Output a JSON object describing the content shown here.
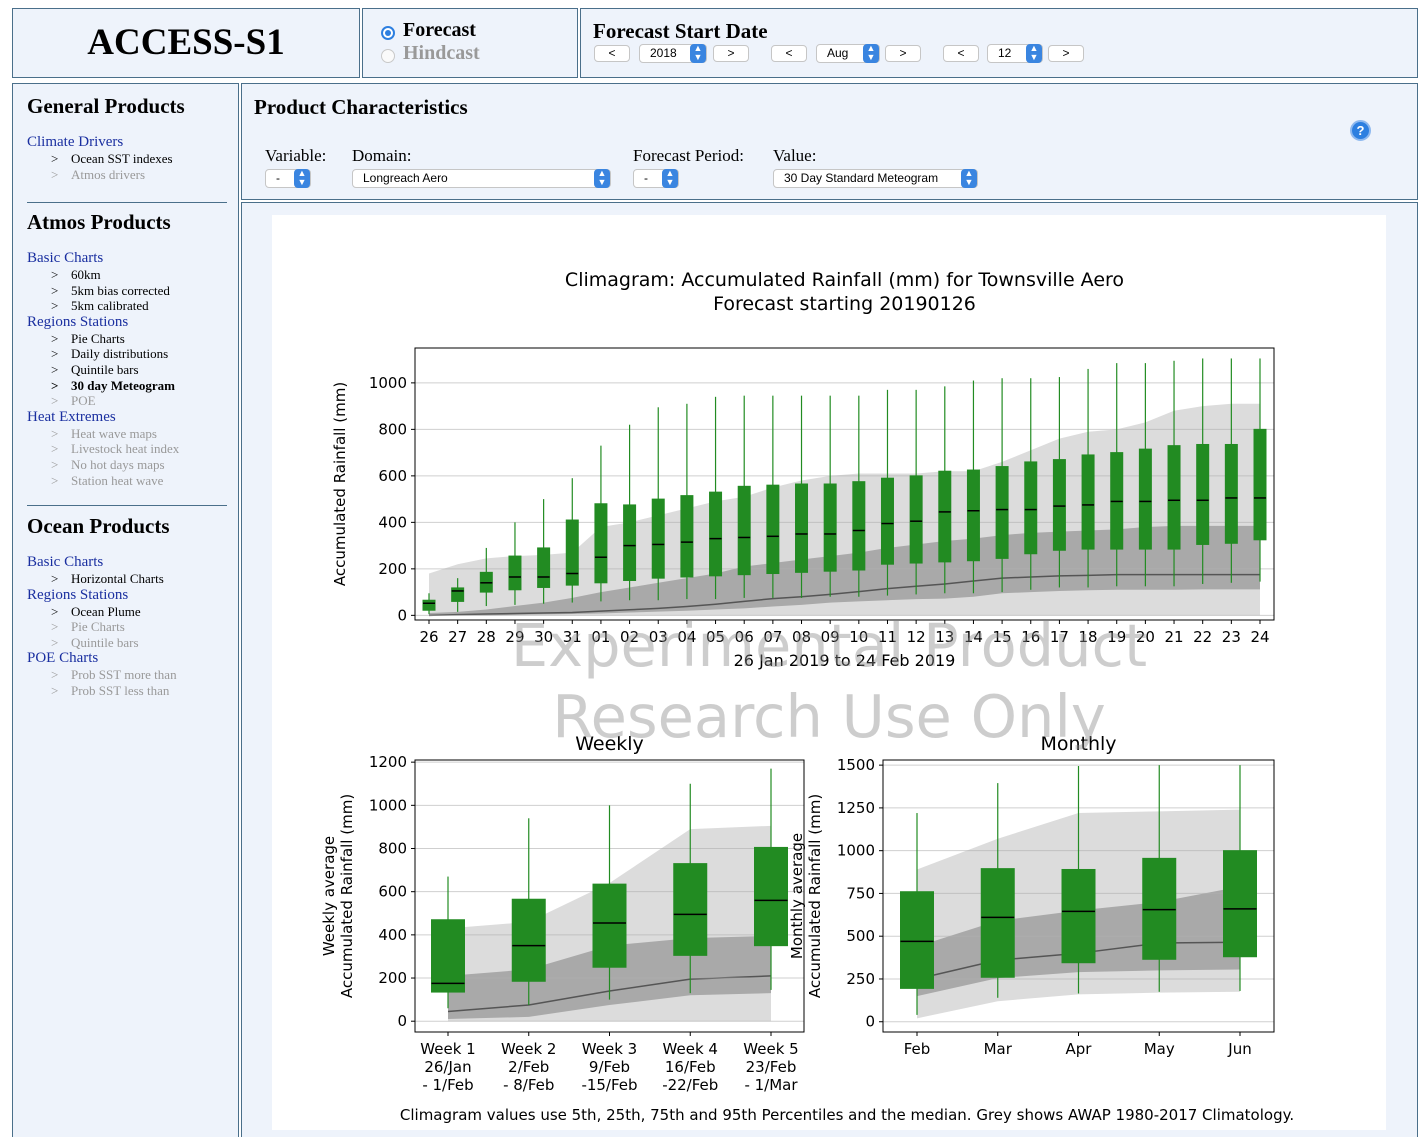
{
  "app": {
    "title": "ACCESS-S1"
  },
  "mode": {
    "forecast_label": "Forecast",
    "hindcast_label": "Hindcast",
    "selected": "Forecast"
  },
  "start_date": {
    "label": "Forecast Start Date",
    "prev": "<",
    "next": ">",
    "year": "2018",
    "month": "Aug",
    "day": "12"
  },
  "sidebar": {
    "general": {
      "heading": "General Products",
      "groups": [
        {
          "label": "Climate Drivers",
          "items": [
            {
              "label": "Ocean SST indexes",
              "state": "active"
            },
            {
              "label": "Atmos drivers",
              "state": "disabled"
            }
          ]
        }
      ]
    },
    "atmos": {
      "heading": "Atmos Products",
      "groups": [
        {
          "label": "Basic Charts",
          "items": [
            {
              "label": "60km",
              "state": "active"
            },
            {
              "label": "5km bias corrected",
              "state": "active"
            },
            {
              "label": "5km calibrated",
              "state": "active"
            }
          ]
        },
        {
          "label": "Regions Stations",
          "items": [
            {
              "label": "Pie Charts",
              "state": "active"
            },
            {
              "label": "Daily distributions",
              "state": "active"
            },
            {
              "label": "Quintile bars",
              "state": "active"
            },
            {
              "label": "30 day Meteogram",
              "state": "selected"
            },
            {
              "label": "POE",
              "state": "disabled"
            }
          ]
        },
        {
          "label": "Heat Extremes",
          "items": [
            {
              "label": "Heat wave maps",
              "state": "disabled"
            },
            {
              "label": "Livestock heat index",
              "state": "disabled"
            },
            {
              "label": "No hot days maps",
              "state": "disabled"
            },
            {
              "label": "Station heat wave",
              "state": "disabled"
            }
          ]
        }
      ]
    },
    "ocean": {
      "heading": "Ocean Products",
      "groups": [
        {
          "label": "Basic Charts",
          "items": [
            {
              "label": "Horizontal Charts",
              "state": "active"
            }
          ]
        },
        {
          "label": "Regions Stations",
          "items": [
            {
              "label": "Ocean Plume",
              "state": "active"
            },
            {
              "label": "Pie Charts",
              "state": "disabled"
            },
            {
              "label": "Quintile bars",
              "state": "disabled"
            }
          ]
        },
        {
          "label": "POE Charts",
          "items": [
            {
              "label": "Prob SST more than",
              "state": "disabled"
            },
            {
              "label": "Prob SST less than",
              "state": "disabled"
            }
          ]
        }
      ]
    },
    "bullet": ">"
  },
  "product": {
    "heading": "Product Characteristics",
    "variable_label": "Variable:",
    "variable_value": "-",
    "domain_label": "Domain:",
    "domain_value": "Longreach Aero",
    "period_label": "Forecast Period:",
    "period_value": "-",
    "value_label": "Value:",
    "value_value": "30 Day Standard Meteogram",
    "help_glyph": "?"
  },
  "watermark": {
    "line1": "Experimental Product",
    "line2": "Research Use Only"
  },
  "footnote": "Climagram values use 5th, 25th, 75th and 95th Percentiles and the median. Grey shows AWAP 1980-2017 Climatology.",
  "colors": {
    "box": "#228b22",
    "clim_light": "#dcdcdc",
    "clim_dark": "#a9a9a9",
    "clim_median": "#555555",
    "panel_bg": "#eef3fb",
    "accent": "#2d7fe0"
  },
  "chart_data": [
    {
      "type": "box",
      "title": "Climagram: Accumulated Rainfall (mm) for Townsville Aero",
      "subtitle": "Forecast starting 20190126",
      "xlabel": "26 Jan 2019 to 24 Feb 2019",
      "ylabel": "Accumulated Rainfall (mm)",
      "ylim": [
        -20,
        1150
      ],
      "yticks": [
        0,
        200,
        400,
        600,
        800,
        1000
      ],
      "categories": [
        "26",
        "27",
        "28",
        "29",
        "30",
        "31",
        "01",
        "02",
        "03",
        "04",
        "05",
        "06",
        "07",
        "08",
        "09",
        "10",
        "11",
        "12",
        "13",
        "14",
        "15",
        "16",
        "17",
        "18",
        "19",
        "20",
        "21",
        "22",
        "23",
        "24"
      ],
      "boxes": [
        [
          5,
          22,
          52,
          65,
          95
        ],
        [
          15,
          60,
          105,
          118,
          160
        ],
        [
          40,
          100,
          140,
          185,
          290
        ],
        [
          45,
          110,
          165,
          255,
          400
        ],
        [
          50,
          120,
          165,
          290,
          500
        ],
        [
          55,
          130,
          180,
          410,
          590
        ],
        [
          60,
          140,
          250,
          480,
          730
        ],
        [
          65,
          150,
          300,
          475,
          820
        ],
        [
          65,
          160,
          305,
          500,
          895
        ],
        [
          70,
          165,
          315,
          515,
          910
        ],
        [
          70,
          170,
          330,
          530,
          940
        ],
        [
          75,
          175,
          335,
          555,
          945
        ],
        [
          75,
          180,
          340,
          560,
          945
        ],
        [
          75,
          185,
          350,
          565,
          945
        ],
        [
          80,
          190,
          350,
          565,
          945
        ],
        [
          80,
          195,
          365,
          575,
          945
        ],
        [
          85,
          220,
          395,
          590,
          970
        ],
        [
          90,
          225,
          405,
          600,
          970
        ],
        [
          95,
          230,
          445,
          620,
          985
        ],
        [
          95,
          235,
          450,
          625,
          1010
        ],
        [
          100,
          245,
          455,
          640,
          1020
        ],
        [
          110,
          265,
          455,
          660,
          1020
        ],
        [
          120,
          280,
          470,
          670,
          1025
        ],
        [
          120,
          285,
          475,
          690,
          1060
        ],
        [
          125,
          285,
          490,
          700,
          1085
        ],
        [
          125,
          285,
          490,
          715,
          1085
        ],
        [
          125,
          285,
          495,
          730,
          1095
        ],
        [
          135,
          305,
          495,
          735,
          1105
        ],
        [
          140,
          310,
          505,
          735,
          1105
        ],
        [
          145,
          325,
          505,
          800,
          1105
        ]
      ],
      "clim": {
        "p5": [
          0,
          0,
          0,
          0,
          0,
          0,
          0,
          0,
          0,
          0,
          0,
          0,
          0,
          0,
          0,
          0,
          0,
          0,
          0,
          0,
          0,
          0,
          0,
          0,
          0,
          0,
          0,
          0,
          0,
          0
        ],
        "p25": [
          0,
          0,
          0,
          2,
          4,
          6,
          8,
          12,
          16,
          20,
          25,
          30,
          38,
          45,
          55,
          60,
          65,
          70,
          72,
          80,
          95,
          100,
          105,
          108,
          110,
          110,
          110,
          112,
          112,
          112
        ],
        "median": [
          0,
          3,
          6,
          8,
          10,
          12,
          18,
          24,
          30,
          38,
          48,
          60,
          72,
          80,
          90,
          102,
          115,
          125,
          135,
          148,
          160,
          165,
          170,
          172,
          175,
          175,
          175,
          175,
          175,
          175
        ],
        "p75": [
          10,
          15,
          25,
          40,
          55,
          75,
          100,
          120,
          140,
          160,
          180,
          210,
          225,
          240,
          255,
          270,
          290,
          305,
          320,
          330,
          345,
          355,
          360,
          365,
          370,
          380,
          385,
          385,
          385,
          385
        ],
        "p95": [
          180,
          220,
          245,
          255,
          260,
          270,
          380,
          400,
          430,
          460,
          490,
          510,
          550,
          580,
          600,
          610,
          610,
          610,
          620,
          620,
          660,
          710,
          760,
          790,
          800,
          830,
          880,
          900,
          910,
          910
        ]
      }
    },
    {
      "type": "box",
      "title": "Weekly",
      "ylabel": "Weekly average\nAccumulated Rainfall (mm)",
      "ylim": [
        -50,
        1210
      ],
      "yticks": [
        0,
        200,
        400,
        600,
        800,
        1000,
        1200
      ],
      "categories": [
        "Week 1\n26/Jan\n- 1/Feb",
        "Week 2\n2/Feb\n- 8/Feb",
        "Week 3\n9/Feb\n-15/Feb",
        "Week 4\n16/Feb\n-22/Feb",
        "Week 5\n23/Feb\n- 1/Mar"
      ],
      "boxes": [
        [
          60,
          135,
          175,
          470,
          670
        ],
        [
          75,
          185,
          350,
          565,
          940
        ],
        [
          100,
          250,
          455,
          635,
          1000
        ],
        [
          130,
          305,
          495,
          730,
          1100
        ],
        [
          145,
          350,
          560,
          805,
          1170
        ]
      ],
      "clim": {
        "p5": [
          0,
          0,
          0,
          0,
          0
        ],
        "p25": [
          10,
          20,
          75,
          120,
          130
        ],
        "median": [
          45,
          75,
          140,
          195,
          210
        ],
        "p75": [
          210,
          240,
          350,
          385,
          395
        ],
        "p95": [
          430,
          460,
          640,
          890,
          905
        ]
      }
    },
    {
      "type": "box",
      "title": "Monthly",
      "ylabel": "Monthly average\nAccumulated Rainfall (mm)",
      "ylim": [
        -60,
        1530
      ],
      "yticks": [
        0,
        250,
        500,
        750,
        1000,
        1250,
        1500
      ],
      "categories": [
        "Feb",
        "Mar",
        "Apr",
        "May",
        "Jun"
      ],
      "boxes": [
        [
          40,
          195,
          470,
          760,
          1220
        ],
        [
          140,
          260,
          610,
          895,
          1395
        ],
        [
          165,
          345,
          645,
          890,
          1495
        ],
        [
          175,
          365,
          655,
          955,
          1500
        ],
        [
          180,
          380,
          660,
          1000,
          1500
        ]
      ],
      "clim": {
        "p5": [
          20,
          120,
          160,
          170,
          175
        ],
        "p25": [
          150,
          255,
          290,
          300,
          305
        ],
        "median": [
          250,
          360,
          400,
          460,
          465
        ],
        "p75": [
          440,
          590,
          650,
          700,
          790
        ],
        "p95": [
          890,
          1070,
          1220,
          1230,
          1240
        ]
      }
    }
  ]
}
